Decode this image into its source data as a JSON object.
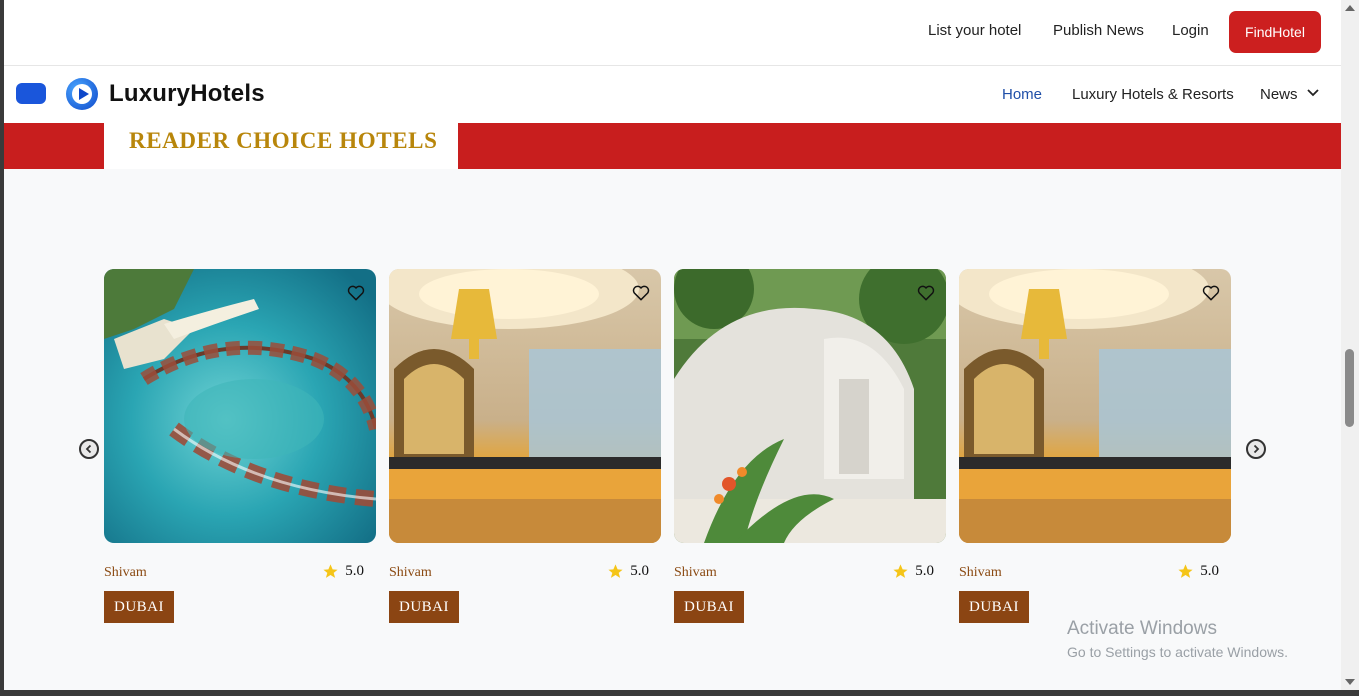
{
  "topbar": {
    "links": [
      "List your hotel",
      "Publish News",
      "Login"
    ],
    "cta": "FindHotel"
  },
  "navbar": {
    "brand": "LuxuryHotels",
    "links": [
      "Home",
      "Luxury Hotels & Resorts",
      "News"
    ]
  },
  "banner": {
    "title": "READER CHOICE HOTELS"
  },
  "cards": [
    {
      "image": "aerial-resort-photo",
      "author": "Shivam",
      "rating": "5.0",
      "location": "DUBAI"
    },
    {
      "image": "hotel-lobby-photo",
      "author": "Shivam",
      "rating": "5.0",
      "location": "DUBAI"
    },
    {
      "image": "dome-villa-photo",
      "author": "Shivam",
      "rating": "5.0",
      "location": "DUBAI"
    },
    {
      "image": "hotel-lobby-photo",
      "author": "Shivam",
      "rating": "5.0",
      "location": "DUBAI"
    }
  ],
  "watermark": {
    "line1": "Activate Windows",
    "line2": "Go to Settings to activate Windows."
  },
  "colors": {
    "accent_red": "#c81e1e",
    "brand_blue": "#1a56db",
    "tag_brown": "#8b4513",
    "gold": "#b8860b"
  }
}
